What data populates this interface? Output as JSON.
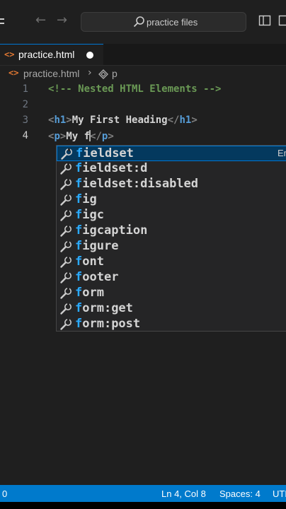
{
  "titlebar": {
    "search_text": "practice files"
  },
  "tab": {
    "icon": "<>",
    "label": "practice.html"
  },
  "breadcrumb": {
    "icon": "<>",
    "file": "practice.html",
    "separator": "›",
    "symbol": "p"
  },
  "editor": {
    "line_numbers": [
      "1",
      "2",
      "3",
      "4"
    ],
    "lines": {
      "l1": "<!-- Nested HTML Elements -->",
      "l3": {
        "open_lt": "<",
        "open_name": "h1",
        "open_gt": ">",
        "text": "My First Heading",
        "close_lt": "</",
        "close_name": "h1",
        "close_gt": ">"
      },
      "l4": {
        "open_lt": "<",
        "open_name": "p",
        "open_gt": ">",
        "text": "My f",
        "close_lt": "</",
        "close_name": "p",
        "close_gt": ">"
      }
    }
  },
  "suggestions": {
    "match": "f",
    "items": [
      {
        "rest": "ieldset",
        "detail": "Em"
      },
      {
        "rest": "ieldset:d",
        "detail": ""
      },
      {
        "rest": "ieldset:disabled",
        "detail": ""
      },
      {
        "rest": "ig",
        "detail": ""
      },
      {
        "rest": "igc",
        "detail": ""
      },
      {
        "rest": "igcaption",
        "detail": ""
      },
      {
        "rest": "igure",
        "detail": ""
      },
      {
        "rest": "ont",
        "detail": ""
      },
      {
        "rest": "ooter",
        "detail": ""
      },
      {
        "rest": "orm",
        "detail": ""
      },
      {
        "rest": "orm:get",
        "detail": ""
      },
      {
        "rest": "orm:post",
        "detail": ""
      }
    ]
  },
  "statusbar": {
    "left": "0",
    "position": "Ln 4, Col 8",
    "spaces": "Spaces: 4",
    "encoding": "UTF"
  },
  "colors": {
    "accent": "#007acc",
    "html_icon": "#e37933",
    "tag": "#569cd6",
    "comment": "#6a9955",
    "match_highlight": "#2aaaff"
  }
}
